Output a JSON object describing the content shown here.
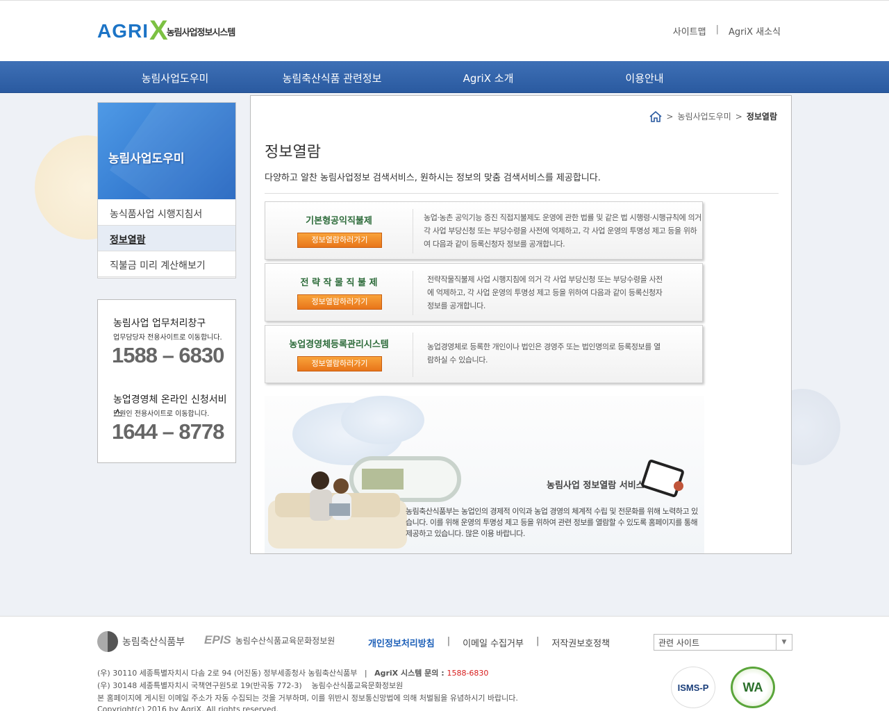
{
  "header": {
    "logo_main": "AGRI",
    "logo_x": "X",
    "logo_sub": "농림사업정보시스템",
    "links": [
      "사이트맵",
      "AgriX 새소식"
    ],
    "sep": "|"
  },
  "gnb": [
    "농림사업도우미",
    "농림축산식품 관련정보",
    "AgriX 소개",
    "이용안내"
  ],
  "lnb": {
    "title": "농림사업도우미",
    "items": [
      "농식품사업 시행지침서",
      "정보열람",
      "직불금 미리 계산해보기"
    ]
  },
  "cs": {
    "title1": "농림사업 업무처리창구",
    "sub1": "업무담당자 전용사이트로 이동합니다.",
    "num1": "1588 – 6830",
    "title2": "농업경영체 온라인 신청서비스",
    "sub2": "민원인 전용사이트로 이동합니다.",
    "num2": "1644 – 8778"
  },
  "content": {
    "breadcrumb": [
      "농림사업도우미",
      "정보열람"
    ],
    "title": "정보열람",
    "desc": "다양하고 알찬 농림사업정보 검색서비스, 원하시는 정보의 맞춤 검색서비스를 제공합니다.",
    "boxes": [
      {
        "title": "기본형공익직불제",
        "button": "정보열람하러가기",
        "desc": "농업·농촌 공익기능 증진 직접지불제도 운영에 관한 법률 및 같은 법 시행령·시행규칙에 의거 각 사업 부당신청 또는 부당수령을 사전에 억제하고, 각 사업 운영의 투명성 제고 등을 위하여 다음과 같이 등록신청자 정보를 공개합니다."
      },
      {
        "title": "전 략 작 물 직 불 제",
        "button": "정보열람하러가기",
        "desc": "전략작물직불제 사업 시행지침에 의거 각 사업 부당신청 또는 부당수령을 사전에 억제하고, 각 사업 운영의 투명성 제고 등을 위하여 다음과 같이 등록신청자 정보를 공개합니다."
      },
      {
        "title": "농업경영체등록관리시스템",
        "button": "정보열람하러가기",
        "desc": "농업경영체로 등록한 개인이나 법인은 경영주 또는 법인명의로 등록정보를 열람하실 수 있습니다."
      }
    ],
    "banner_title": "농림사업 정보열람 서비스",
    "banner_text": "농림축산식품부는 농업인의 경제적 이익과 농업 경영의 체계적 수립 및 전문화를 위해 노력하고 있습니다. 이를 위해 운영의 투명성 제고 등을 위하여 관련 정보를 열람할 수 있도록 홈페이지를 통해 제공하고 있습니다. 많은 이용 바랍니다."
  },
  "footer": {
    "ministry": "농림축산식품부",
    "epis": "EPIS",
    "epis_name": "농림수산식품교육문화정보원",
    "links": [
      "개인정보처리방침",
      "이메일 수집거부",
      "저작권보호정책"
    ],
    "sep": "|",
    "select": "관련 사이트",
    "addr1": "(우) 30110 세종특별자치시 다솜 2로 94 (어진동) 정부세종청사 농림축산식품부   |   ",
    "addr1_agrix": "AgriX 시스템 문의 : ",
    "addr1_phone": "1588-6830",
    "addr2": "(우) 30148 세종특별자치시 국책연구원5로 19(반곡동 772-3)    농림수산식품교육문화정보원",
    "addr3": "본 홈페이지에 게시된 이메일 주소가 자동 수집되는 것을 거부하며, 이를 위반시 정보통신망법에 의해 처벌됨을 유념하시기 바랍니다.",
    "addr4": "Copyright(c) 2016 by AgriX. All rights reserved.",
    "cert1": "ISMS-P",
    "cert2": "WA"
  }
}
